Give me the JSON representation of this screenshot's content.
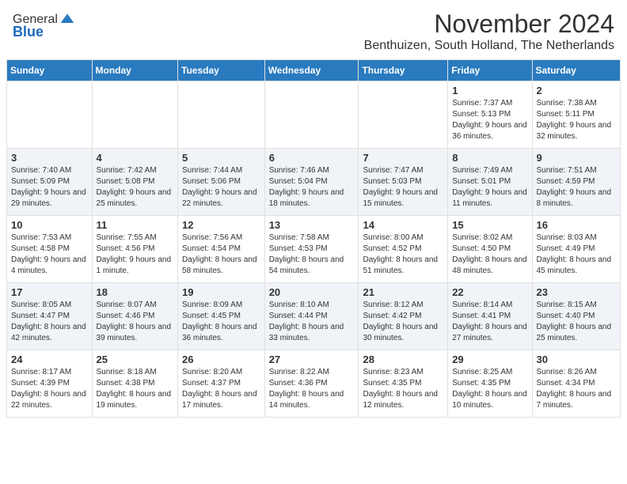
{
  "header": {
    "logo_general": "General",
    "logo_blue": "Blue",
    "month_title": "November 2024",
    "location": "Benthuizen, South Holland, The Netherlands"
  },
  "weekdays": [
    "Sunday",
    "Monday",
    "Tuesday",
    "Wednesday",
    "Thursday",
    "Friday",
    "Saturday"
  ],
  "weeks": [
    [
      {
        "day": "",
        "info": ""
      },
      {
        "day": "",
        "info": ""
      },
      {
        "day": "",
        "info": ""
      },
      {
        "day": "",
        "info": ""
      },
      {
        "day": "",
        "info": ""
      },
      {
        "day": "1",
        "info": "Sunrise: 7:37 AM\nSunset: 5:13 PM\nDaylight: 9 hours and 36 minutes."
      },
      {
        "day": "2",
        "info": "Sunrise: 7:38 AM\nSunset: 5:11 PM\nDaylight: 9 hours and 32 minutes."
      }
    ],
    [
      {
        "day": "3",
        "info": "Sunrise: 7:40 AM\nSunset: 5:09 PM\nDaylight: 9 hours and 29 minutes."
      },
      {
        "day": "4",
        "info": "Sunrise: 7:42 AM\nSunset: 5:08 PM\nDaylight: 9 hours and 25 minutes."
      },
      {
        "day": "5",
        "info": "Sunrise: 7:44 AM\nSunset: 5:06 PM\nDaylight: 9 hours and 22 minutes."
      },
      {
        "day": "6",
        "info": "Sunrise: 7:46 AM\nSunset: 5:04 PM\nDaylight: 9 hours and 18 minutes."
      },
      {
        "day": "7",
        "info": "Sunrise: 7:47 AM\nSunset: 5:03 PM\nDaylight: 9 hours and 15 minutes."
      },
      {
        "day": "8",
        "info": "Sunrise: 7:49 AM\nSunset: 5:01 PM\nDaylight: 9 hours and 11 minutes."
      },
      {
        "day": "9",
        "info": "Sunrise: 7:51 AM\nSunset: 4:59 PM\nDaylight: 9 hours and 8 minutes."
      }
    ],
    [
      {
        "day": "10",
        "info": "Sunrise: 7:53 AM\nSunset: 4:58 PM\nDaylight: 9 hours and 4 minutes."
      },
      {
        "day": "11",
        "info": "Sunrise: 7:55 AM\nSunset: 4:56 PM\nDaylight: 9 hours and 1 minute."
      },
      {
        "day": "12",
        "info": "Sunrise: 7:56 AM\nSunset: 4:54 PM\nDaylight: 8 hours and 58 minutes."
      },
      {
        "day": "13",
        "info": "Sunrise: 7:58 AM\nSunset: 4:53 PM\nDaylight: 8 hours and 54 minutes."
      },
      {
        "day": "14",
        "info": "Sunrise: 8:00 AM\nSunset: 4:52 PM\nDaylight: 8 hours and 51 minutes."
      },
      {
        "day": "15",
        "info": "Sunrise: 8:02 AM\nSunset: 4:50 PM\nDaylight: 8 hours and 48 minutes."
      },
      {
        "day": "16",
        "info": "Sunrise: 8:03 AM\nSunset: 4:49 PM\nDaylight: 8 hours and 45 minutes."
      }
    ],
    [
      {
        "day": "17",
        "info": "Sunrise: 8:05 AM\nSunset: 4:47 PM\nDaylight: 8 hours and 42 minutes."
      },
      {
        "day": "18",
        "info": "Sunrise: 8:07 AM\nSunset: 4:46 PM\nDaylight: 8 hours and 39 minutes."
      },
      {
        "day": "19",
        "info": "Sunrise: 8:09 AM\nSunset: 4:45 PM\nDaylight: 8 hours and 36 minutes."
      },
      {
        "day": "20",
        "info": "Sunrise: 8:10 AM\nSunset: 4:44 PM\nDaylight: 8 hours and 33 minutes."
      },
      {
        "day": "21",
        "info": "Sunrise: 8:12 AM\nSunset: 4:42 PM\nDaylight: 8 hours and 30 minutes."
      },
      {
        "day": "22",
        "info": "Sunrise: 8:14 AM\nSunset: 4:41 PM\nDaylight: 8 hours and 27 minutes."
      },
      {
        "day": "23",
        "info": "Sunrise: 8:15 AM\nSunset: 4:40 PM\nDaylight: 8 hours and 25 minutes."
      }
    ],
    [
      {
        "day": "24",
        "info": "Sunrise: 8:17 AM\nSunset: 4:39 PM\nDaylight: 8 hours and 22 minutes."
      },
      {
        "day": "25",
        "info": "Sunrise: 8:18 AM\nSunset: 4:38 PM\nDaylight: 8 hours and 19 minutes."
      },
      {
        "day": "26",
        "info": "Sunrise: 8:20 AM\nSunset: 4:37 PM\nDaylight: 8 hours and 17 minutes."
      },
      {
        "day": "27",
        "info": "Sunrise: 8:22 AM\nSunset: 4:36 PM\nDaylight: 8 hours and 14 minutes."
      },
      {
        "day": "28",
        "info": "Sunrise: 8:23 AM\nSunset: 4:35 PM\nDaylight: 8 hours and 12 minutes."
      },
      {
        "day": "29",
        "info": "Sunrise: 8:25 AM\nSunset: 4:35 PM\nDaylight: 8 hours and 10 minutes."
      },
      {
        "day": "30",
        "info": "Sunrise: 8:26 AM\nSunset: 4:34 PM\nDaylight: 8 hours and 7 minutes."
      }
    ]
  ]
}
